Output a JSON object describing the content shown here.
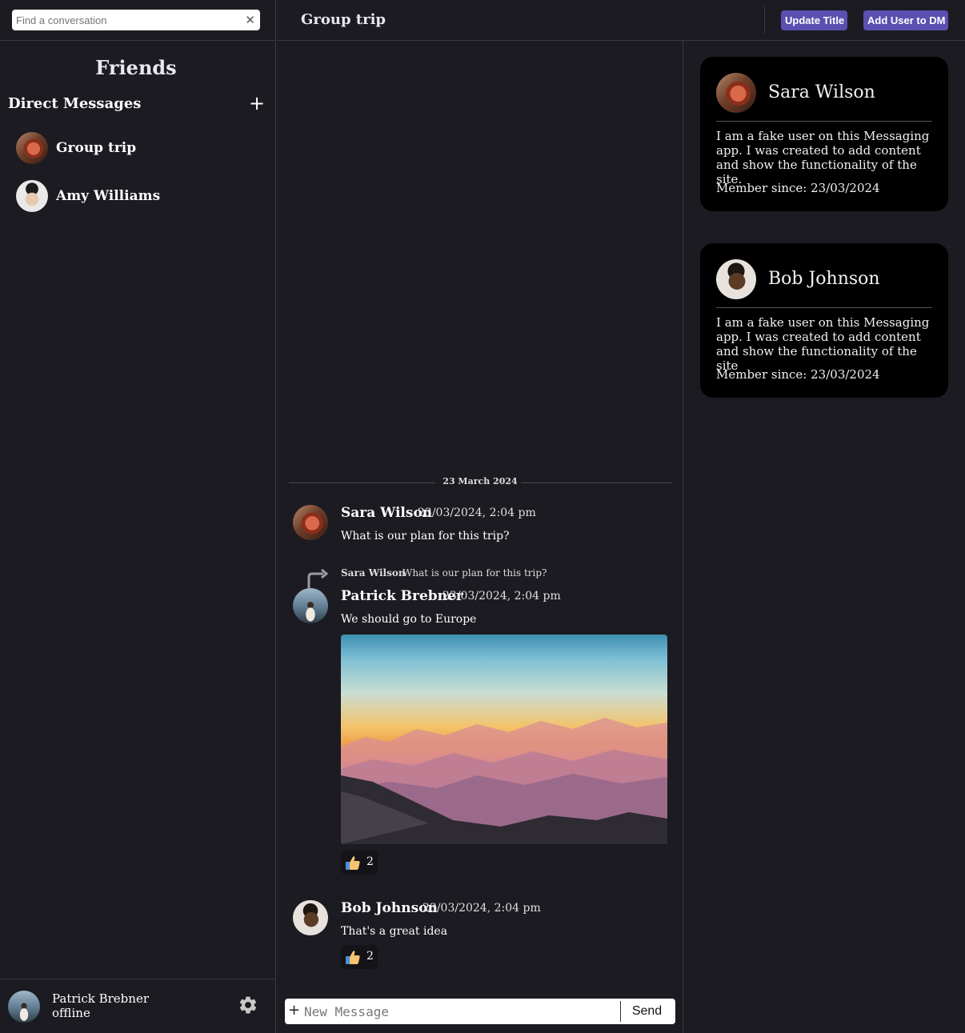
{
  "search": {
    "placeholder": "Find a conversation",
    "clear_icon": "close-icon"
  },
  "sidebar": {
    "title": "Friends",
    "section_label": "Direct Messages",
    "add_icon": "plus-icon",
    "items": [
      {
        "label": "Group trip",
        "avatar": "sara"
      },
      {
        "label": "Amy Williams",
        "avatar": "amy"
      }
    ]
  },
  "current_user": {
    "name": "Patrick Brebner",
    "status": "offline",
    "settings_icon": "gear-icon"
  },
  "header": {
    "title": "Group trip",
    "update_title_label": "Update Title",
    "add_user_label": "Add User to DM"
  },
  "chat": {
    "date_divider": "23 March 2024",
    "messages": [
      {
        "author": "Sara Wilson",
        "time": "23/03/2024, 2:04 pm",
        "text": "What is our plan for this trip?",
        "avatar": "sara"
      },
      {
        "author": "Patrick Brebner",
        "time": "23/03/2024, 2:04 pm",
        "text": "We should go to Europe",
        "avatar": "patrick",
        "reply_to": {
          "author": "Sara Wilson",
          "text": "What is our plan for this trip?"
        },
        "image": "mountain-sunset-photo",
        "reaction": {
          "emoji": "thumbs-up",
          "count": "2"
        }
      },
      {
        "author": "Bob Johnson",
        "time": "23/03/2024, 2:04 pm",
        "text": "That's a great idea",
        "avatar": "bob",
        "reaction": {
          "emoji": "thumbs-up",
          "count": "2"
        }
      }
    ]
  },
  "composer": {
    "placeholder": "New Message",
    "send_label": "Send",
    "attach_label": "+"
  },
  "members": [
    {
      "name": "Sara Wilson",
      "bio": "I am a fake user on this Messaging app. I was created to add content and show the functionality of the site.",
      "since": "Member since: 23/03/2024",
      "avatar": "sara"
    },
    {
      "name": "Bob Johnson",
      "bio": "I am a fake user on this Messaging app. I was created to add content and show the functionality of the site",
      "since": "Member since: 23/03/2024",
      "avatar": "bob"
    }
  ],
  "colors": {
    "background": "#1c1b21",
    "accent_button": "#5b4fb1",
    "card": "#000000",
    "border": "#3a3940"
  }
}
